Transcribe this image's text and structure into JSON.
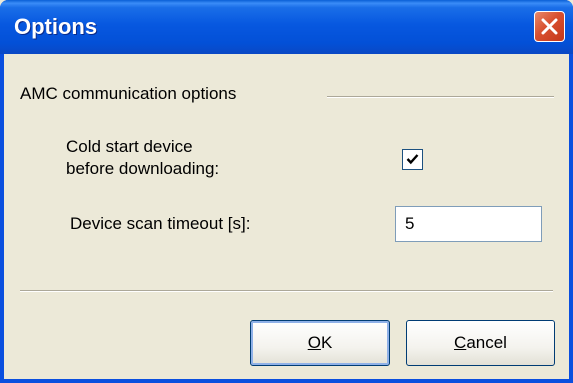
{
  "window": {
    "title": "Options"
  },
  "group": {
    "label": "AMC communication options"
  },
  "cold_start": {
    "label_line1": "Cold start device",
    "label_line2": "before downloading:",
    "checked": true
  },
  "scan_timeout": {
    "label": "Device scan timeout [s]:",
    "value": "5"
  },
  "buttons": {
    "ok_mnemonic": "O",
    "ok_rest": "K",
    "cancel_mnemonic": "C",
    "cancel_rest": "ancel"
  },
  "icons": {
    "close": "close-icon",
    "check": "checkmark-icon"
  },
  "colors": {
    "titlebar": "#0758e0",
    "window_bg": "#ece9d8",
    "close_button": "#d8502f"
  }
}
